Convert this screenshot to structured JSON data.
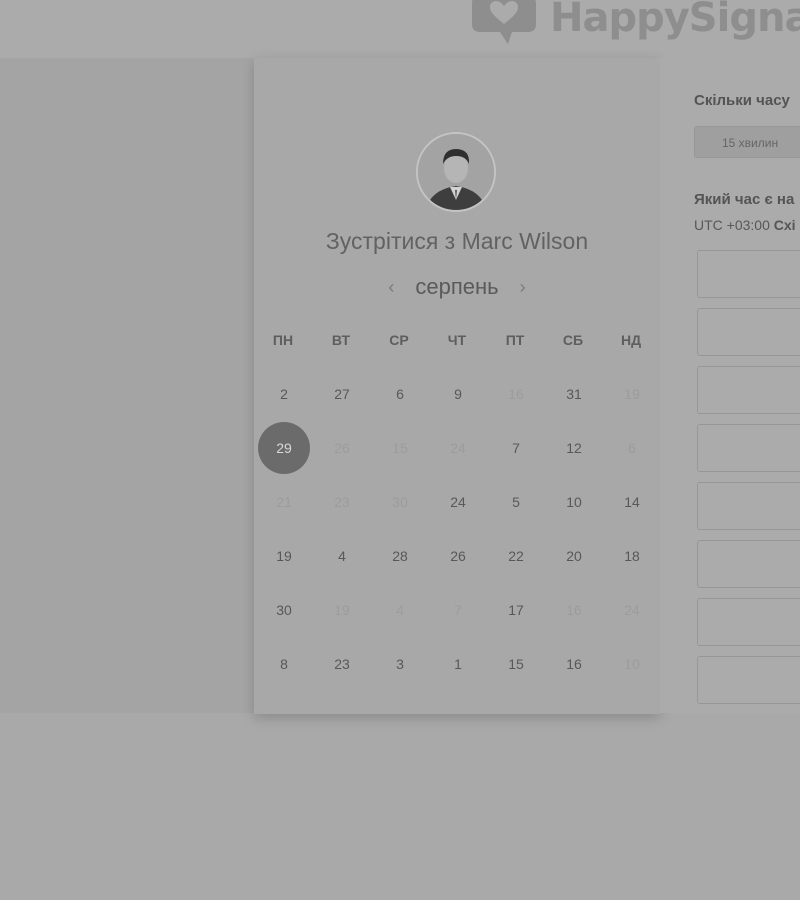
{
  "header": {
    "logo_text": "HappySigna",
    "logo_icon": "speech-bubble-heart-icon"
  },
  "calendar": {
    "title_prefix": "Зустрітися з",
    "host_name": "Marc Wilson",
    "month": "серпень",
    "prev_icon": "‹",
    "next_icon": "›",
    "weekdays": [
      "ПН",
      "ВТ",
      "СР",
      "ЧТ",
      "ПТ",
      "СБ",
      "НД"
    ],
    "selected": "29",
    "rows": [
      [
        {
          "d": "2",
          "s": "a"
        },
        {
          "d": "27",
          "s": "a"
        },
        {
          "d": "6",
          "s": "a"
        },
        {
          "d": "9",
          "s": "a"
        },
        {
          "d": "16",
          "s": "m"
        },
        {
          "d": "31",
          "s": "a"
        },
        {
          "d": "19",
          "s": "m"
        }
      ],
      [
        {
          "d": "29",
          "s": "sel"
        },
        {
          "d": "26",
          "s": "m"
        },
        {
          "d": "15",
          "s": "m"
        },
        {
          "d": "24",
          "s": "m"
        },
        {
          "d": "7",
          "s": "a"
        },
        {
          "d": "12",
          "s": "a"
        },
        {
          "d": "6",
          "s": "m"
        }
      ],
      [
        {
          "d": "21",
          "s": "m"
        },
        {
          "d": "23",
          "s": "m"
        },
        {
          "d": "30",
          "s": "m"
        },
        {
          "d": "24",
          "s": "a"
        },
        {
          "d": "5",
          "s": "a"
        },
        {
          "d": "10",
          "s": "a"
        },
        {
          "d": "14",
          "s": "a"
        }
      ],
      [
        {
          "d": "19",
          "s": "a"
        },
        {
          "d": "4",
          "s": "a"
        },
        {
          "d": "28",
          "s": "a"
        },
        {
          "d": "26",
          "s": "a"
        },
        {
          "d": "22",
          "s": "a"
        },
        {
          "d": "20",
          "s": "a"
        },
        {
          "d": "18",
          "s": "a"
        }
      ],
      [
        {
          "d": "30",
          "s": "a"
        },
        {
          "d": "19",
          "s": "m"
        },
        {
          "d": "4",
          "s": "m"
        },
        {
          "d": "7",
          "s": "m"
        },
        {
          "d": "17",
          "s": "a"
        },
        {
          "d": "16",
          "s": "m"
        },
        {
          "d": "24",
          "s": "m"
        }
      ],
      [
        {
          "d": "8",
          "s": "a"
        },
        {
          "d": "23",
          "s": "a"
        },
        {
          "d": "3",
          "s": "a"
        },
        {
          "d": "1",
          "s": "a"
        },
        {
          "d": "15",
          "s": "a"
        },
        {
          "d": "16",
          "s": "a"
        },
        {
          "d": "10",
          "s": "m"
        }
      ]
    ]
  },
  "booking": {
    "duration_question": "Скільки часу",
    "duration_option": "15 хвилин",
    "time_question": "Який час є на",
    "timezone_offset": "UTC +03:00",
    "timezone_name": "Схі",
    "slot_count": 8
  },
  "colors": {
    "selected_day": "#6b6b6b",
    "available_day_text": "#585858",
    "unavailable_day_text": "#9c9c9c"
  }
}
